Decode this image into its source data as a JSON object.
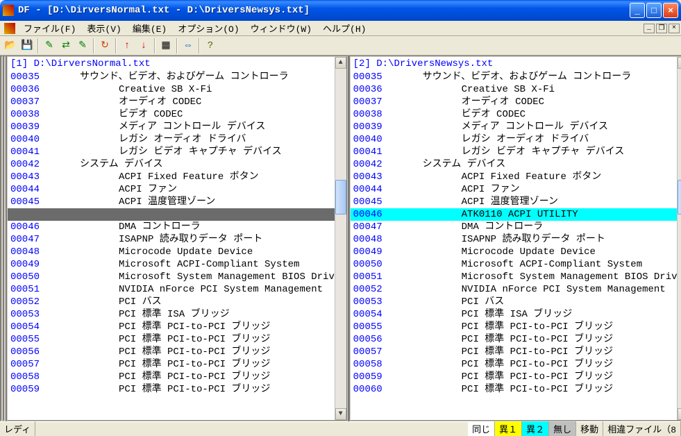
{
  "title": "DF - [D:\\DirversNormal.txt  -  D:\\DriversNewsys.txt]",
  "menu": {
    "file": "ファイル(F)",
    "view": "表示(V)",
    "edit": "編集(E)",
    "option": "オプション(O)",
    "window": "ウィンドウ(W)",
    "help": "ヘルプ(H)"
  },
  "toolbar_icons": [
    "open",
    "save",
    "edit-left",
    "swap",
    "edit-right",
    "refresh",
    "copy-right",
    "copy-left",
    "compare",
    "both",
    "help"
  ],
  "panes": {
    "left": {
      "title": "[1] D:\\DirversNormal.txt"
    },
    "right": {
      "title": "[2] D:\\DriversNewsys.txt"
    }
  },
  "status": {
    "ready": "レディ",
    "same": "同じ",
    "diff1": "異１",
    "diff2": "異２",
    "none": "無し",
    "move": "移動",
    "difffile": "相違ファイル（8"
  },
  "left_lines": [
    {
      "n": "00035",
      "ind": 1,
      "t": "サウンド、ビデオ、およびゲーム コントローラ"
    },
    {
      "n": "00036",
      "ind": 2,
      "t": "Creative SB X-Fi"
    },
    {
      "n": "00037",
      "ind": 2,
      "t": "オーディオ CODEC"
    },
    {
      "n": "00038",
      "ind": 2,
      "t": "ビデオ CODEC"
    },
    {
      "n": "00039",
      "ind": 2,
      "t": "メディア コントロール デバイス"
    },
    {
      "n": "00040",
      "ind": 2,
      "t": "レガシ オーディオ ドライバ"
    },
    {
      "n": "00041",
      "ind": 2,
      "t": "レガシ ビデオ キャプチャ デバイス"
    },
    {
      "n": "00042",
      "ind": 1,
      "t": "システム デバイス"
    },
    {
      "n": "00043",
      "ind": 2,
      "t": "ACPI Fixed Feature ボタン"
    },
    {
      "n": "00044",
      "ind": 2,
      "t": "ACPI ファン"
    },
    {
      "n": "00045",
      "ind": 2,
      "t": "ACPI 温度管理ゾーン"
    },
    {
      "n": "",
      "ind": 0,
      "t": "",
      "hl": "gray"
    },
    {
      "n": "00046",
      "ind": 2,
      "t": "DMA コントローラ"
    },
    {
      "n": "00047",
      "ind": 2,
      "t": "ISAPNP 読み取りデータ ポート"
    },
    {
      "n": "00048",
      "ind": 2,
      "t": "Microcode Update Device"
    },
    {
      "n": "00049",
      "ind": 2,
      "t": "Microsoft ACPI-Compliant System"
    },
    {
      "n": "00050",
      "ind": 2,
      "t": "Microsoft System Management BIOS Driver"
    },
    {
      "n": "00051",
      "ind": 2,
      "t": "NVIDIA nForce PCI System Management"
    },
    {
      "n": "00052",
      "ind": 2,
      "t": "PCI バス"
    },
    {
      "n": "00053",
      "ind": 2,
      "t": "PCI 標準 ISA ブリッジ"
    },
    {
      "n": "00054",
      "ind": 2,
      "t": "PCI 標準 PCI-to-PCI ブリッジ"
    },
    {
      "n": "00055",
      "ind": 2,
      "t": "PCI 標準 PCI-to-PCI ブリッジ"
    },
    {
      "n": "00056",
      "ind": 2,
      "t": "PCI 標準 PCI-to-PCI ブリッジ"
    },
    {
      "n": "00057",
      "ind": 2,
      "t": "PCI 標準 PCI-to-PCI ブリッジ"
    },
    {
      "n": "00058",
      "ind": 2,
      "t": "PCI 標準 PCI-to-PCI ブリッジ"
    },
    {
      "n": "00059",
      "ind": 2,
      "t": "PCI 標準 PCI-to-PCI ブリッジ"
    }
  ],
  "right_lines": [
    {
      "n": "00035",
      "ind": 1,
      "t": "サウンド、ビデオ、およびゲーム コントローラ"
    },
    {
      "n": "00036",
      "ind": 2,
      "t": "Creative SB X-Fi"
    },
    {
      "n": "00037",
      "ind": 2,
      "t": "オーディオ CODEC"
    },
    {
      "n": "00038",
      "ind": 2,
      "t": "ビデオ CODEC"
    },
    {
      "n": "00039",
      "ind": 2,
      "t": "メディア コントロール デバイス"
    },
    {
      "n": "00040",
      "ind": 2,
      "t": "レガシ オーディオ ドライバ"
    },
    {
      "n": "00041",
      "ind": 2,
      "t": "レガシ ビデオ キャプチャ デバイス"
    },
    {
      "n": "00042",
      "ind": 1,
      "t": "システム デバイス"
    },
    {
      "n": "00043",
      "ind": 2,
      "t": "ACPI Fixed Feature ボタン"
    },
    {
      "n": "00044",
      "ind": 2,
      "t": "ACPI ファン"
    },
    {
      "n": "00045",
      "ind": 2,
      "t": "ACPI 温度管理ゾーン"
    },
    {
      "n": "00046",
      "ind": 2,
      "t": "ATK0110 ACPI UTILITY",
      "hl": "cyan"
    },
    {
      "n": "00047",
      "ind": 2,
      "t": "DMA コントローラ"
    },
    {
      "n": "00048",
      "ind": 2,
      "t": "ISAPNP 読み取りデータ ポート"
    },
    {
      "n": "00049",
      "ind": 2,
      "t": "Microcode Update Device"
    },
    {
      "n": "00050",
      "ind": 2,
      "t": "Microsoft ACPI-Compliant System"
    },
    {
      "n": "00051",
      "ind": 2,
      "t": "Microsoft System Management BIOS Driver"
    },
    {
      "n": "00052",
      "ind": 2,
      "t": "NVIDIA nForce PCI System Management"
    },
    {
      "n": "00053",
      "ind": 2,
      "t": "PCI バス"
    },
    {
      "n": "00054",
      "ind": 2,
      "t": "PCI 標準 ISA ブリッジ"
    },
    {
      "n": "00055",
      "ind": 2,
      "t": "PCI 標準 PCI-to-PCI ブリッジ"
    },
    {
      "n": "00056",
      "ind": 2,
      "t": "PCI 標準 PCI-to-PCI ブリッジ"
    },
    {
      "n": "00057",
      "ind": 2,
      "t": "PCI 標準 PCI-to-PCI ブリッジ"
    },
    {
      "n": "00058",
      "ind": 2,
      "t": "PCI 標準 PCI-to-PCI ブリッジ"
    },
    {
      "n": "00059",
      "ind": 2,
      "t": "PCI 標準 PCI-to-PCI ブリッジ"
    },
    {
      "n": "00060",
      "ind": 2,
      "t": "PCI 標準 PCI-to-PCI ブリッジ"
    }
  ],
  "strip_colors": [
    [
      "#ffff00",
      "#00ffff"
    ],
    [
      "#00ffff",
      "#00ffff"
    ],
    [
      "#ffff00",
      "#00ffff"
    ],
    [
      "#000000",
      "#000000"
    ],
    [
      "#000000",
      "#000000"
    ],
    [
      "#ffff00",
      "#00ffff"
    ],
    [
      "#ff0000",
      "#000000"
    ],
    [
      "#000000",
      "#00ffff"
    ],
    [
      "#000000",
      "#000000"
    ],
    [
      "#000000",
      "#000000"
    ],
    [
      "#ffff00",
      "#ffff00"
    ],
    [
      "#ff0000",
      "#000000"
    ],
    [
      "#6b6b6b",
      "#00ffff"
    ],
    [
      "#000000",
      "#000000"
    ],
    [
      "#ff0000",
      "#ff0000"
    ],
    [
      "#000000",
      "#000000"
    ],
    [
      "#000000",
      "#000000"
    ],
    [
      "#000000",
      "#000000"
    ],
    [
      "#000000",
      "#000000"
    ],
    [
      "#000000",
      "#000000"
    ],
    [
      "#ffff00",
      "#00ffff"
    ],
    [
      "#000000",
      "#000000"
    ],
    [
      "#000000",
      "#000000"
    ],
    [
      "#ffff00",
      "#00ffff"
    ],
    [
      "#000000",
      "#000000"
    ],
    [
      "#ffff00",
      "#00ffff"
    ],
    [
      "#000000",
      "#000000"
    ],
    [
      "#000000",
      "#000000"
    ]
  ]
}
